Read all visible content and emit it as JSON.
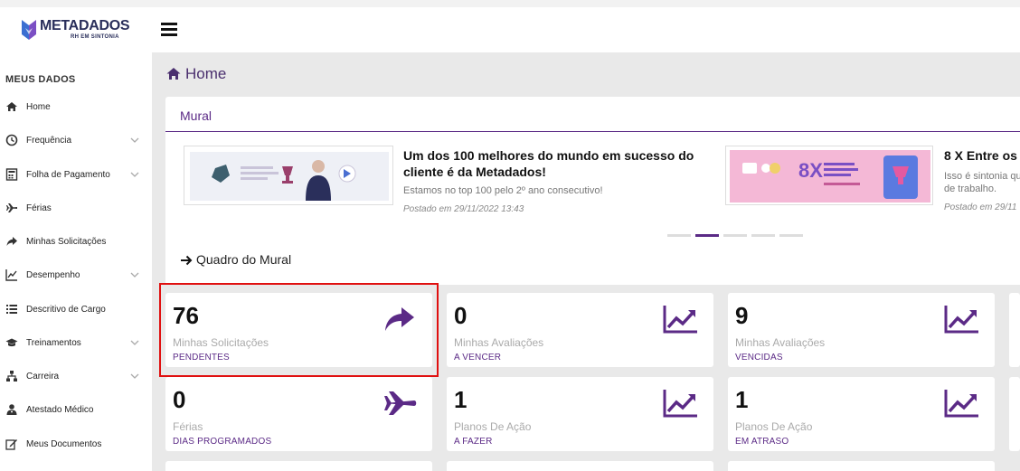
{
  "brand": {
    "name": "METADADOS",
    "tagline": "RH EM SINTONIA",
    "accent": "#5b2a86",
    "highlight": "#e01010"
  },
  "sidebar": {
    "title": "MEUS DADOS",
    "items": [
      {
        "label": "Home",
        "icon": "home-icon",
        "chevron": false
      },
      {
        "label": "Frequência",
        "icon": "clock-icon",
        "chevron": true
      },
      {
        "label": "Folha de Pagamento",
        "icon": "calculator-icon",
        "chevron": true
      },
      {
        "label": "Férias",
        "icon": "plane-icon",
        "chevron": false
      },
      {
        "label": "Minhas Solicitações",
        "icon": "share-icon",
        "chevron": false
      },
      {
        "label": "Desempenho",
        "icon": "line-chart-icon",
        "chevron": true
      },
      {
        "label": "Descritivo de Cargo",
        "icon": "list-icon",
        "chevron": false
      },
      {
        "label": "Treinamentos",
        "icon": "graduation-cap-icon",
        "chevron": true
      },
      {
        "label": "Carreira",
        "icon": "sitemap-icon",
        "chevron": true
      },
      {
        "label": "Atestado Médico",
        "icon": "user-md-icon",
        "chevron": false
      },
      {
        "label": "Meus Documentos",
        "icon": "edit-icon",
        "chevron": false
      }
    ]
  },
  "page": {
    "title": "Home"
  },
  "mural": {
    "title": "Mural",
    "posts": [
      {
        "title_line1": "Um dos 100 melhores do mundo em sucesso do",
        "title_line2": "cliente é da Metadados!",
        "description": "Estamos no top 100 pelo 2º ano consecutivo!",
        "date": "Postado em 29/11/2022 13:43"
      },
      {
        "title_line1": "8 X Entre os",
        "description_line1": "Isso é sintonia qu",
        "description_line2": "de trabalho.",
        "date": "Postado em 29/11",
        "image_text": "8X"
      }
    ],
    "carousel_dots": 5,
    "carousel_active": 1,
    "link": "Quadro do Mural"
  },
  "cards": [
    {
      "value": "76",
      "caption": "Minhas Solicitações",
      "sub": "PENDENTES",
      "icon": "share-icon"
    },
    {
      "value": "0",
      "caption": "Minhas Avaliações",
      "sub": "A VENCER",
      "icon": "area-chart-icon"
    },
    {
      "value": "9",
      "caption": "Minhas Avaliações",
      "sub": "VENCIDAS",
      "icon": "area-chart-icon"
    },
    {
      "value": "0",
      "caption": "Férias",
      "sub": "DIAS PROGRAMADOS",
      "icon": "plane-icon"
    },
    {
      "value": "1",
      "caption": "Planos De Ação",
      "sub": "A FAZER",
      "icon": "area-chart-icon"
    },
    {
      "value": "1",
      "caption": "Planos De Ação",
      "sub": "EM ATRASO",
      "icon": "area-chart-icon"
    }
  ]
}
